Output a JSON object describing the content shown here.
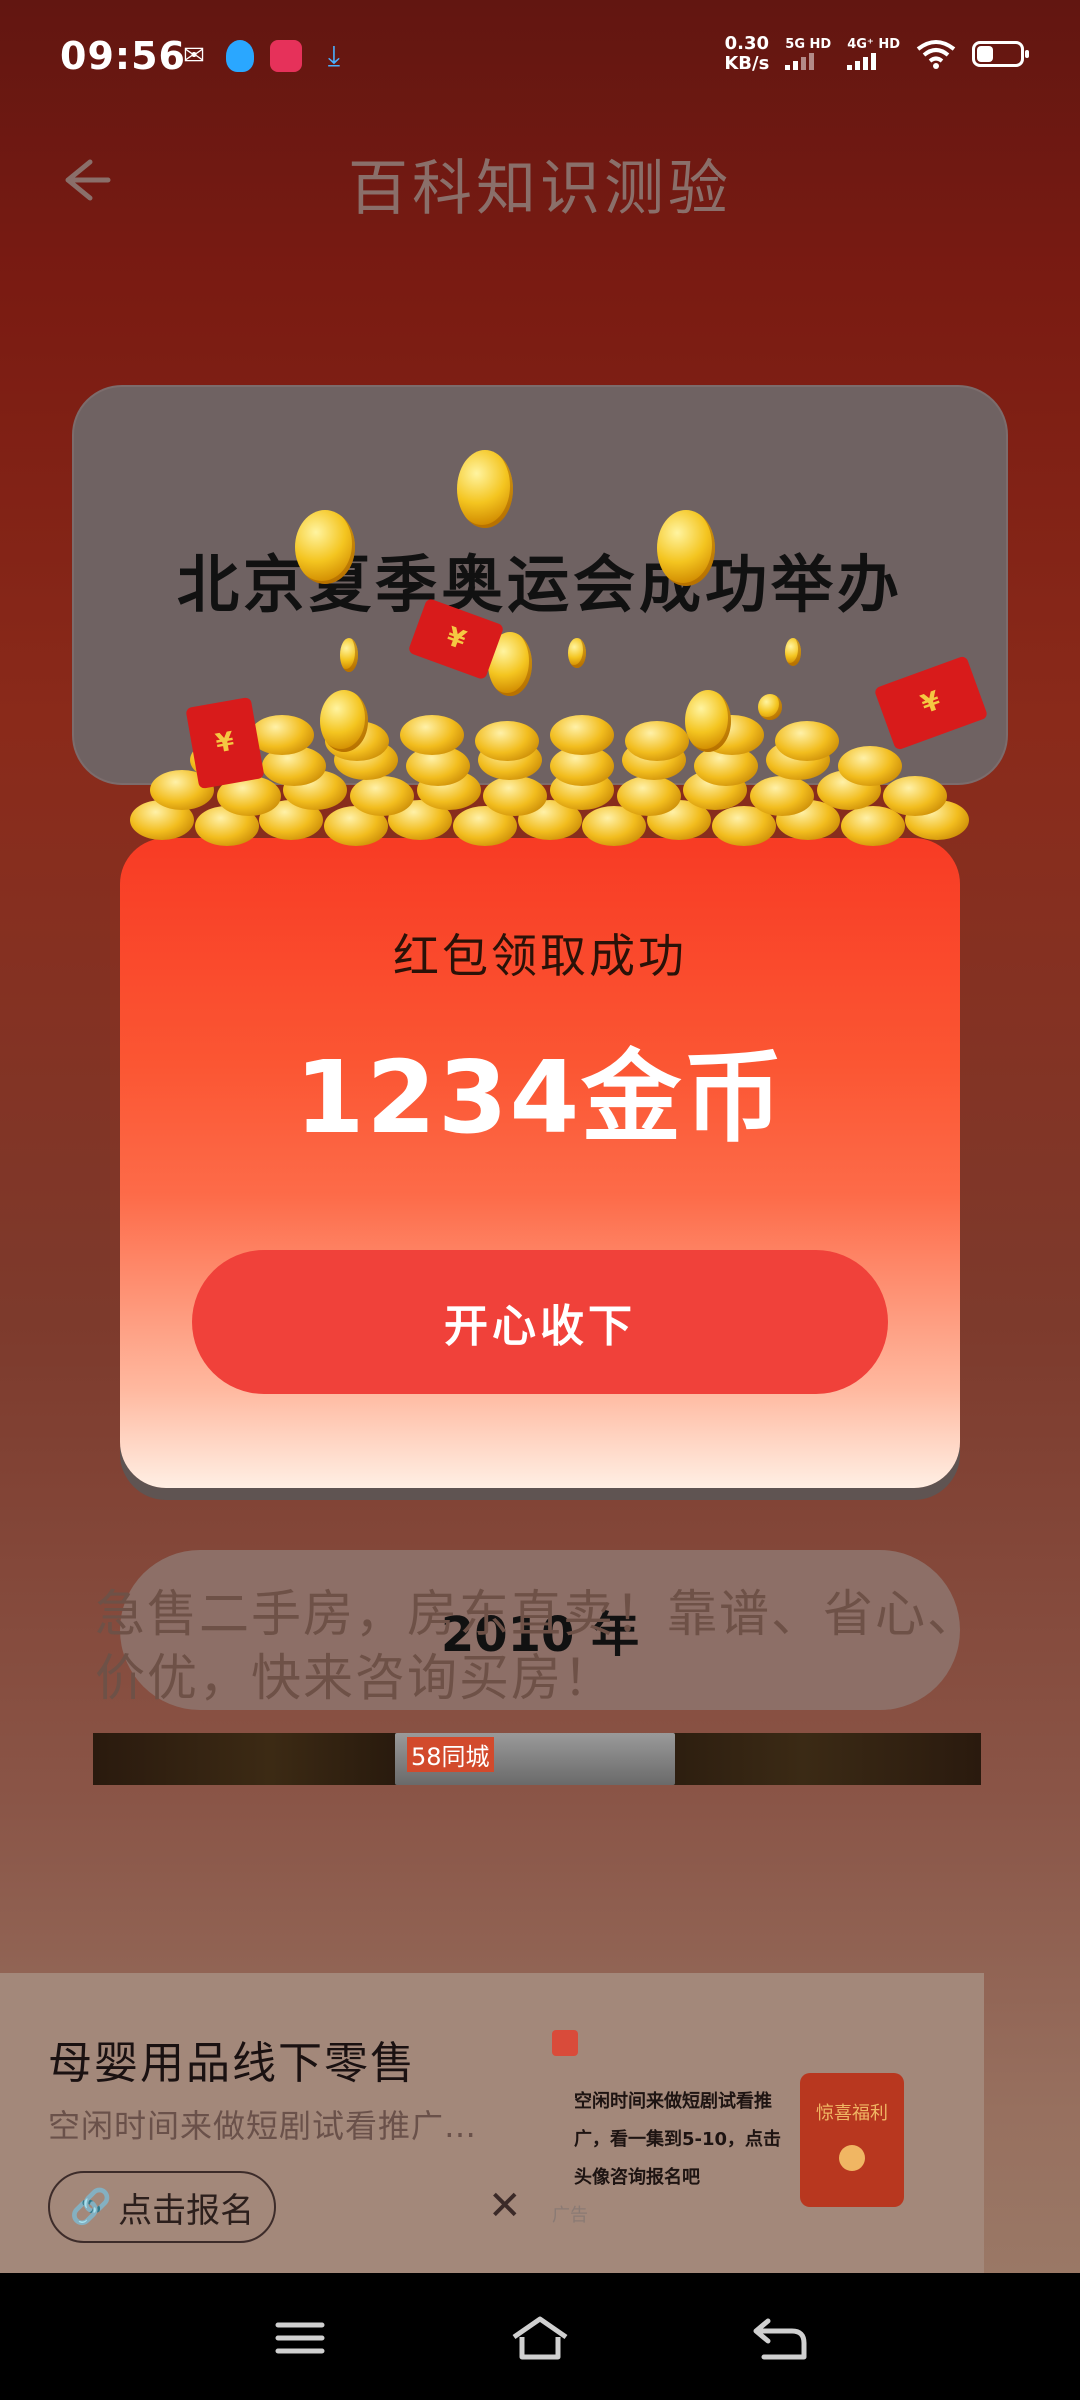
{
  "status_bar": {
    "time": "09:56",
    "net_speed_value": "0.30",
    "net_speed_unit": "KB/s",
    "sim1_label": "5G HD",
    "sim2_label": "4G⁺ HD",
    "battery_level": 0.35,
    "notification_icons": [
      "wechat-icon",
      "qq-icon",
      "app-icon",
      "download-icon"
    ]
  },
  "header": {
    "title": "百科知识测验"
  },
  "quiz": {
    "question": "北京夏季奥运会成功举办",
    "option_text": "2010 年"
  },
  "background_ad": {
    "text": "急售二手房，房东直卖！靠谱、省心、价优，快来咨询买房！",
    "thumb_tag": "58同城"
  },
  "reward_popup": {
    "title": "红包领取成功",
    "amount": "1234金币",
    "accept_label": "开心收下",
    "currency_symbol": "¥"
  },
  "bottom_ad": {
    "title": "母婴用品线下零售",
    "subtitle": "空闲时间来做短剧试看推广…",
    "signup_label": "点击报名",
    "close_label": "✕",
    "thumb_text": "空闲时间来做短剧试看推广，看一集到5-10，点击头像咨询报名吧",
    "thumb_badge": "惊喜福利",
    "thumb_tag": "广告"
  },
  "colors": {
    "card_red": "#f83b24",
    "button_red": "#f0413a",
    "backdrop_dark": "#621611"
  }
}
